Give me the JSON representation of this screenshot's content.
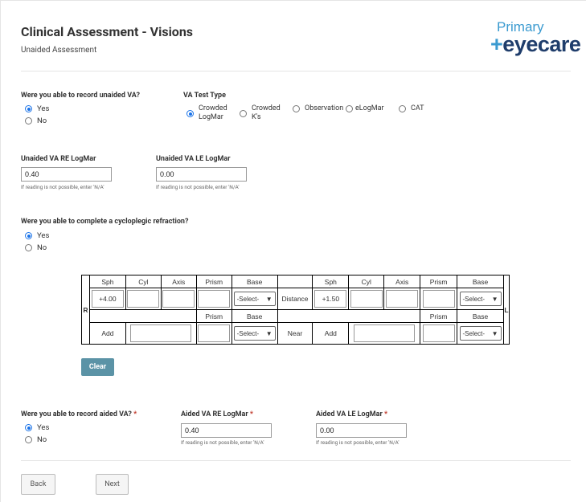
{
  "header": {
    "title": "Clinical Assessment - Visions",
    "subtitle": "Unaided Assessment",
    "logo_top": "Primary",
    "logo_cross": "+",
    "logo_bottom": "eyecare"
  },
  "unaided": {
    "question": "Were you able to record unaided VA?",
    "options": [
      "Yes",
      "No"
    ],
    "selected": "Yes"
  },
  "va_test_type": {
    "label": "VA Test Type",
    "options": [
      "Crowded LogMar",
      "Crowded K's",
      "Observation",
      "eLogMar",
      "CAT"
    ],
    "option_line1": [
      "Crowded",
      "Crowded",
      "Observation",
      "eLogMar",
      "CAT"
    ],
    "option_line2": [
      "LogMar",
      "K's",
      "",
      "",
      ""
    ],
    "selected": "Crowded LogMar"
  },
  "unaided_va": {
    "re_label": "Unaided VA RE LogMar",
    "re_value": "0.40",
    "le_label": "Unaided VA LE LogMar",
    "le_value": "0.00",
    "hint": "If reading is not possible, enter 'N/A'"
  },
  "cycloplegic": {
    "question": "Were you able to complete a cycloplegic refraction?",
    "options": [
      "Yes",
      "No"
    ],
    "selected": "Yes"
  },
  "refraction": {
    "right_marker": "R",
    "left_marker": "L",
    "headers": [
      "Sph",
      "Cyl",
      "Axis",
      "Prism",
      "Base"
    ],
    "distance_label": "Distance",
    "near_label": "Near",
    "add_label": "Add",
    "prism_label": "Prism",
    "base_label": "Base",
    "select_placeholder": "-Select-",
    "right_sph": "+4.00",
    "left_sph": "+1.50"
  },
  "clear_button": "Clear",
  "aided": {
    "question": "Were you able to record aided VA?",
    "required_mark": "*",
    "options": [
      "Yes",
      "No"
    ],
    "selected": "Yes",
    "re_label": "Aided VA RE LogMar",
    "re_value": "0.40",
    "le_label": "Aided VA LE LogMar",
    "le_value": "0.00",
    "hint": "If reading is not possible, enter 'N/A'"
  },
  "nav": {
    "back": "Back",
    "next": "Next"
  }
}
